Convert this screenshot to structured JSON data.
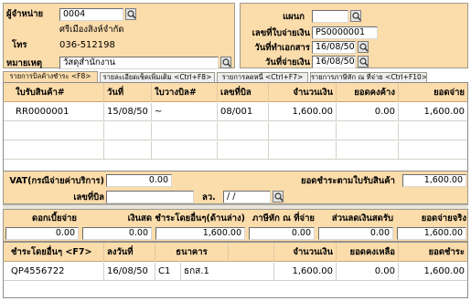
{
  "header": {
    "vendor_label": "ผู้จำหน่าย",
    "vendor_code": "0004",
    "vendor_name": "ศรีเมืองสิงห์จำกัด",
    "phone_label": "โทร",
    "phone_value": "036-512198",
    "note_label": "หมายเหตุ",
    "note_value": "วัสดุสำนักงาน",
    "dept_label": "แผนก",
    "dept_value": "",
    "payment_no_label": "เลขที่ใบจ่ายเงิน",
    "payment_no_value": "PS0000001",
    "doc_date_label": "วันที่ทำเอกสาร",
    "doc_date_value": "16/08/50",
    "pay_date_label": "วันที่จ่ายเงิน",
    "pay_date_value": "16/08/50"
  },
  "tabs": [
    {
      "label": "รายการบิลค้างชำระ <F8>",
      "active": true
    },
    {
      "label": "รายละเอียดเช็คเพิ่มเติม <Ctrl+F8>",
      "active": false
    },
    {
      "label": "รายการลดหนี้ <Ctrl+F7>",
      "active": false
    },
    {
      "label": "รายการภาษีหัก ณ ที่จ่าย <Ctrl+F10>",
      "active": false
    }
  ],
  "invoice_table": {
    "columns": [
      "ใบรับสินค้า#",
      "วันที่",
      "ใบวางบิล#",
      "เลขที่บิล",
      "จำนวนเงิน",
      "ยอดคงค้าง",
      "ยอดจ่าย"
    ],
    "rows": [
      [
        "RR0000001",
        "15/08/50",
        "~",
        "08/001",
        "1,600.00",
        "0.00",
        "1,600.00"
      ]
    ]
  },
  "summary": {
    "vat_label": "VAT(กรณีจ่ายค่าบริการ)",
    "vat_value": "0.00",
    "total_due_label": "ยอดชำระตามใบรับสินค้า",
    "total_due_value": "1,600.00",
    "bill_no_label": "เลขที่บิล",
    "bill_no_value": "",
    "date_label": "ลว.",
    "date_value": " /  / "
  },
  "payment": {
    "labels": [
      "ดอกเบี้ยจ่าย",
      "เงินสด",
      "ชำระโดยอื่นๆ(ด้านล่าง)",
      "ภาษีหัก ณ ที่จ่าย",
      "ส่วนลดเงินสดรับ",
      "ยอดจ่ายจริง"
    ],
    "values": [
      "0.00",
      "0.00",
      "1,600.00",
      "0.00",
      "0.00",
      "1,600.00"
    ]
  },
  "other_table": {
    "columns": [
      "ชำระโดยอื่นๆ <F7>",
      "ลงวันที่",
      "ธนาคาร",
      "",
      "จำนวนเงิน",
      "ยอดคงเหลือ",
      "ยอดชำระ"
    ],
    "rows": [
      [
        "QP4556722",
        "16/08/50",
        "C1",
        "ธกส.1",
        "1,600.00",
        "0.00",
        "1,600.00"
      ]
    ]
  },
  "colors": {
    "panel_bg": "#fbdcab",
    "field_bg": "#ffffff",
    "border": "#9d9a8c"
  },
  "icons": [
    "search-icon"
  ]
}
